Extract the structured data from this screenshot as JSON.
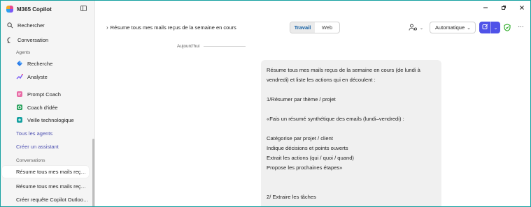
{
  "app": {
    "title": "M365 Copilot"
  },
  "sidebar": {
    "search_label": "Rechercher",
    "conversation_label": "Conversation",
    "agents_header": "Agents",
    "agents": [
      {
        "label": "Recherche",
        "icon": "research-icon"
      },
      {
        "label": "Analyste",
        "icon": "analyst-icon"
      },
      {
        "label": "Prompt Coach",
        "icon": "prompt-coach-icon"
      },
      {
        "label": "Coach d'idée",
        "icon": "idea-coach-icon"
      },
      {
        "label": "Veille technologique",
        "icon": "tech-watch-icon"
      }
    ],
    "all_agents_link": "Tous les agents",
    "create_assistant_link": "Créer un assistant",
    "conversations_header": "Conversations",
    "conversations": [
      {
        "label": "Résume tous mes mails reçu…",
        "active": true
      },
      {
        "label": "Résume tous mes mails reçus…",
        "active": false
      },
      {
        "label": "Créer requête Copilot Outloo…",
        "active": false
      }
    ]
  },
  "header": {
    "breadcrumb": "Résume tous mes mails reçus de la semaine en cours",
    "tabs": [
      {
        "label": "Travail",
        "selected": true
      },
      {
        "label": "Web",
        "selected": false
      }
    ],
    "model_select": "Automatique"
  },
  "chat": {
    "date_separator": "Aujourd'hui",
    "message_lines": [
      "Résume tous mes mails reçus de la semaine en cours (de lundi à",
      "vendredi) et liste les actions qui en découlent :",
      "",
      "1/Résumer par thème / projet",
      "",
      "«Fais un résumé synthétique des emails (lundi–vendredi) :",
      "",
      "Catégorise par projet / client",
      "Indique décisions et points ouverts",
      "Extrait les actions (qui / quoi / quand)",
      "Propose les prochaines étapes»",
      "",
      "",
      "2/ Extraire les tâches"
    ]
  },
  "colors": {
    "accent": "#4f52e8",
    "selected_tab": "#115ea3",
    "link": "#4f52b2",
    "window_border": "#14a0a0",
    "bubble_bg": "#f0f0f0",
    "shield_green": "#13a10e"
  }
}
